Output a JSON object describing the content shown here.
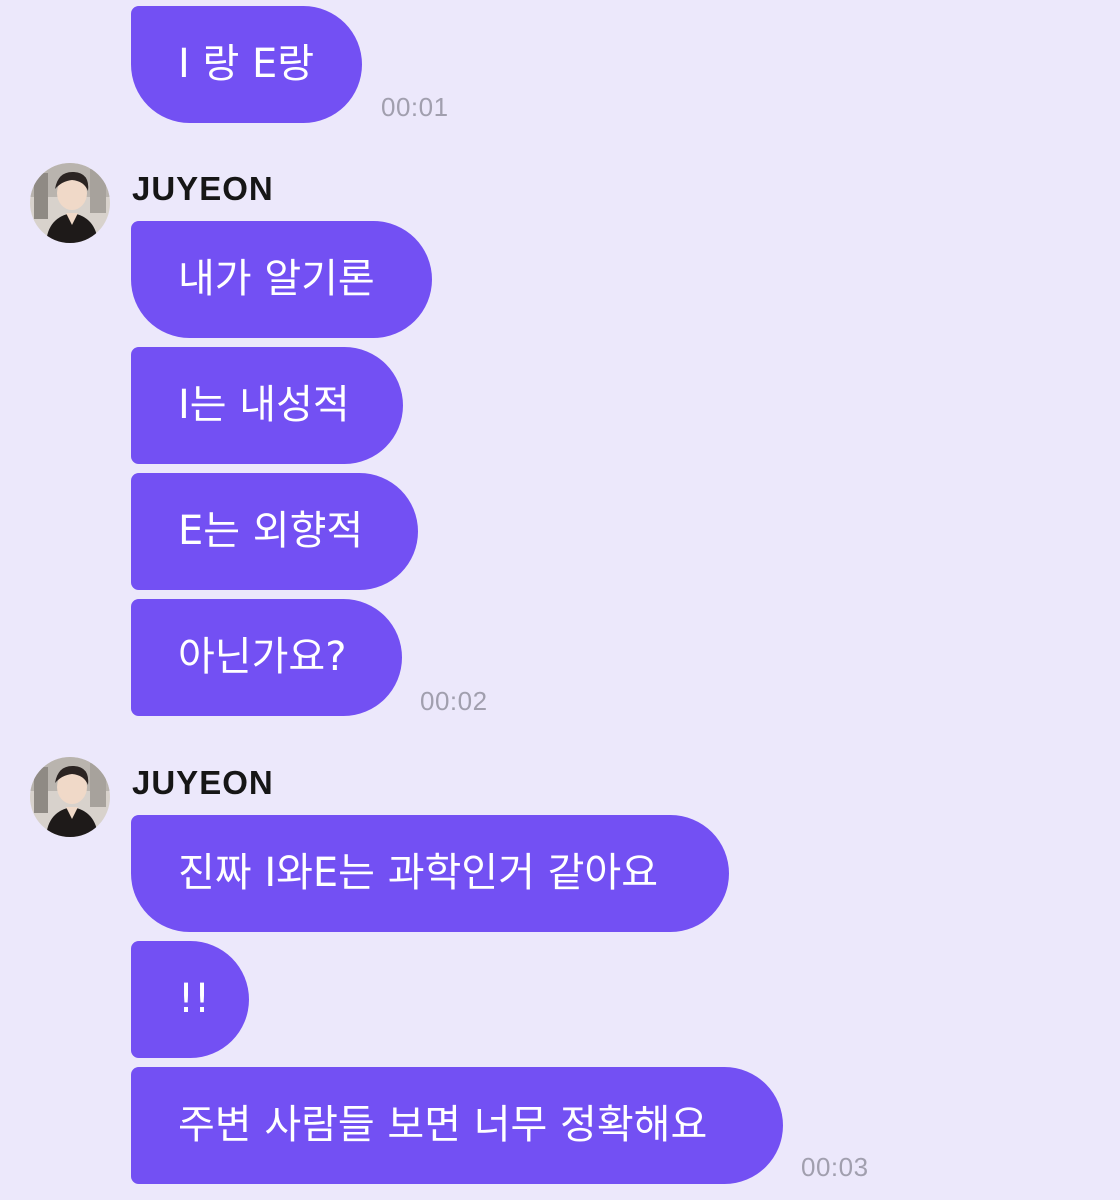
{
  "messages": [
    {
      "text": "I 랑 E랑"
    },
    {
      "sender": "JUYEON"
    },
    {
      "text": "내가 알기론"
    },
    {
      "text": "I는 내성적"
    },
    {
      "text": "E는 외향적"
    },
    {
      "text": "아닌가요?"
    },
    {
      "sender": "JUYEON"
    },
    {
      "text": "진짜 I와E는 과학인거 같아요"
    },
    {
      "text": "!!"
    },
    {
      "text": "주변 사람들 보면 너무 정확해요"
    }
  ],
  "times": [
    "00:01",
    "00:02",
    "00:03"
  ],
  "colors": {
    "background": "#ece8fb",
    "bubble": "#7350f3",
    "bubble_text": "#ffffff",
    "timestamp": "#a19fae",
    "sender_name": "#161616"
  }
}
